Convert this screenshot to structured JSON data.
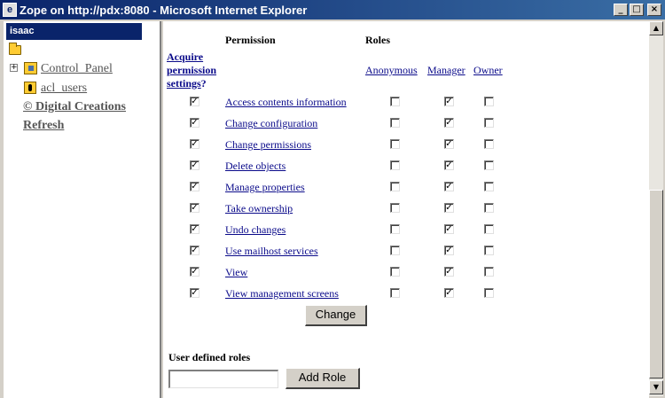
{
  "window": {
    "title": "Zope on http://pdx:8080 - Microsoft Internet Explorer",
    "minimize": "_",
    "maximize": "□",
    "close": "×"
  },
  "tree": {
    "user": "isaac",
    "expander": "+",
    "items": [
      "Control_Panel",
      "acl_users"
    ],
    "links": [
      "© Digital Creations",
      "Refresh"
    ]
  },
  "permissions": {
    "headers": {
      "permission": "Permission",
      "roles": "Roles",
      "acquire": [
        "Acquire",
        "permission",
        "settings"
      ],
      "acquire_suffix": "?"
    },
    "roles": [
      "Anonymous",
      "Manager",
      "Owner"
    ],
    "check_glyph": "✓",
    "rows": [
      {
        "name": "Access contents information",
        "acquire": true,
        "anonymous": false,
        "manager": true,
        "owner": false
      },
      {
        "name": "Change configuration",
        "acquire": true,
        "anonymous": false,
        "manager": true,
        "owner": false
      },
      {
        "name": "Change permissions",
        "acquire": true,
        "anonymous": false,
        "manager": true,
        "owner": false
      },
      {
        "name": "Delete objects",
        "acquire": true,
        "anonymous": false,
        "manager": true,
        "owner": false
      },
      {
        "name": "Manage properties",
        "acquire": true,
        "anonymous": false,
        "manager": true,
        "owner": false
      },
      {
        "name": "Take ownership",
        "acquire": true,
        "anonymous": false,
        "manager": true,
        "owner": false
      },
      {
        "name": "Undo changes",
        "acquire": true,
        "anonymous": false,
        "manager": true,
        "owner": false
      },
      {
        "name": "Use mailhost services",
        "acquire": true,
        "anonymous": false,
        "manager": true,
        "owner": false
      },
      {
        "name": "View",
        "acquire": true,
        "anonymous": false,
        "manager": true,
        "owner": false
      },
      {
        "name": "View management screens",
        "acquire": true,
        "anonymous": false,
        "manager": true,
        "owner": false
      }
    ],
    "change_label": "Change"
  },
  "user_roles": {
    "label": "User defined roles",
    "input_value": "",
    "add_label": "Add Role"
  },
  "scrollbar": {
    "up": "▲",
    "down": "▼"
  }
}
